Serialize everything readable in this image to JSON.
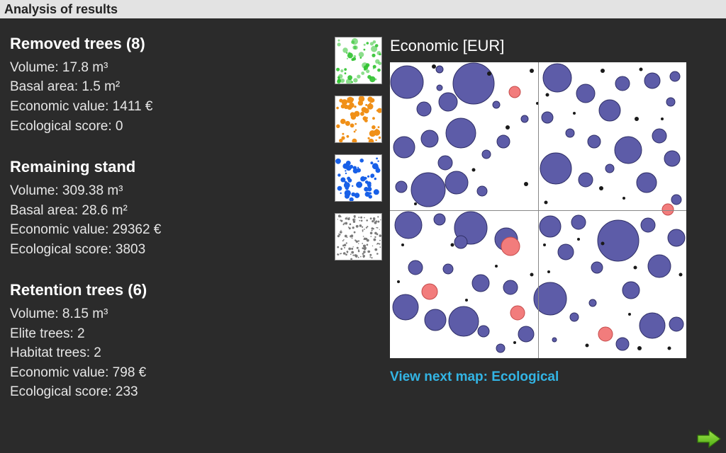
{
  "title": "Analysis of results",
  "removed": {
    "heading": "Removed trees (8)",
    "volume": "Volume: 17.8 m³",
    "basal": "Basal area: 1.5 m²",
    "econ": "Economic value: 1411 €",
    "eco": "Ecological score: 0"
  },
  "remaining": {
    "heading": "Remaining stand",
    "volume": "Volume: 309.38 m³",
    "basal": "Basal area: 28.6 m²",
    "econ": "Economic value: 29362 €",
    "eco": "Ecological score: 3803"
  },
  "retention": {
    "heading": "Retention trees (6)",
    "volume": "Volume: 8.15 m³",
    "elite": "Elite trees: 2",
    "habitat": "Habitat trees: 2",
    "econ": "Economic value: 798 €",
    "eco": "Ecological score: 233"
  },
  "map": {
    "title": "Economic [EUR]",
    "next_label": "View next map: Ecological"
  },
  "thumbs": [
    {
      "name": "thumb-green",
      "color": "#2ec22e"
    },
    {
      "name": "thumb-orange",
      "color": "#f09018"
    },
    {
      "name": "thumb-blue",
      "color": "#1860e8"
    },
    {
      "name": "thumb-gray",
      "color": "#7a7a7a"
    }
  ],
  "chart_data": {
    "type": "scatter",
    "title": "Economic [EUR]",
    "xlim": [
      0,
      418
    ],
    "ylim": [
      0,
      418
    ],
    "note": "Map of tree positions and relative economic value (circle radius ~ value). Salmon circles mark highlighted trees.",
    "series": [
      {
        "name": "main",
        "color": "#5d5ca8",
        "points": [
          {
            "x": 24,
            "y": 28,
            "r": 23
          },
          {
            "x": 70,
            "y": 10,
            "r": 5
          },
          {
            "x": 118,
            "y": 30,
            "r": 29
          },
          {
            "x": 48,
            "y": 66,
            "r": 10
          },
          {
            "x": 82,
            "y": 56,
            "r": 13
          },
          {
            "x": 70,
            "y": 36,
            "r": 4
          },
          {
            "x": 20,
            "y": 120,
            "r": 15
          },
          {
            "x": 56,
            "y": 108,
            "r": 12
          },
          {
            "x": 100,
            "y": 100,
            "r": 21
          },
          {
            "x": 78,
            "y": 142,
            "r": 10
          },
          {
            "x": 16,
            "y": 176,
            "r": 8
          },
          {
            "x": 54,
            "y": 180,
            "r": 24
          },
          {
            "x": 94,
            "y": 170,
            "r": 16
          },
          {
            "x": 130,
            "y": 182,
            "r": 7
          },
          {
            "x": 136,
            "y": 130,
            "r": 6
          },
          {
            "x": 160,
            "y": 112,
            "r": 9
          },
          {
            "x": 190,
            "y": 80,
            "r": 5
          },
          {
            "x": 150,
            "y": 60,
            "r": 5
          },
          {
            "x": 236,
            "y": 22,
            "r": 20
          },
          {
            "x": 276,
            "y": 44,
            "r": 13
          },
          {
            "x": 328,
            "y": 30,
            "r": 10
          },
          {
            "x": 310,
            "y": 68,
            "r": 15
          },
          {
            "x": 222,
            "y": 78,
            "r": 8
          },
          {
            "x": 254,
            "y": 100,
            "r": 6
          },
          {
            "x": 288,
            "y": 112,
            "r": 9
          },
          {
            "x": 370,
            "y": 26,
            "r": 11
          },
          {
            "x": 402,
            "y": 20,
            "r": 7
          },
          {
            "x": 396,
            "y": 56,
            "r": 6
          },
          {
            "x": 234,
            "y": 150,
            "r": 22
          },
          {
            "x": 276,
            "y": 166,
            "r": 10
          },
          {
            "x": 310,
            "y": 150,
            "r": 6
          },
          {
            "x": 336,
            "y": 124,
            "r": 19
          },
          {
            "x": 380,
            "y": 104,
            "r": 10
          },
          {
            "x": 362,
            "y": 170,
            "r": 14
          },
          {
            "x": 398,
            "y": 136,
            "r": 11
          },
          {
            "x": 404,
            "y": 194,
            "r": 7
          },
          {
            "x": 26,
            "y": 230,
            "r": 19
          },
          {
            "x": 70,
            "y": 222,
            "r": 8
          },
          {
            "x": 114,
            "y": 234,
            "r": 23
          },
          {
            "x": 100,
            "y": 254,
            "r": 9
          },
          {
            "x": 164,
            "y": 250,
            "r": 16
          },
          {
            "x": 36,
            "y": 290,
            "r": 10
          },
          {
            "x": 82,
            "y": 292,
            "r": 7
          },
          {
            "x": 128,
            "y": 312,
            "r": 12
          },
          {
            "x": 170,
            "y": 318,
            "r": 10
          },
          {
            "x": 22,
            "y": 346,
            "r": 18
          },
          {
            "x": 64,
            "y": 364,
            "r": 15
          },
          {
            "x": 104,
            "y": 366,
            "r": 21
          },
          {
            "x": 132,
            "y": 380,
            "r": 8
          },
          {
            "x": 156,
            "y": 404,
            "r": 6
          },
          {
            "x": 192,
            "y": 384,
            "r": 11
          },
          {
            "x": 226,
            "y": 232,
            "r": 15
          },
          {
            "x": 266,
            "y": 226,
            "r": 10
          },
          {
            "x": 248,
            "y": 268,
            "r": 11
          },
          {
            "x": 322,
            "y": 252,
            "r": 29
          },
          {
            "x": 292,
            "y": 290,
            "r": 8
          },
          {
            "x": 364,
            "y": 230,
            "r": 10
          },
          {
            "x": 404,
            "y": 248,
            "r": 12
          },
          {
            "x": 380,
            "y": 288,
            "r": 16
          },
          {
            "x": 226,
            "y": 334,
            "r": 23
          },
          {
            "x": 260,
            "y": 360,
            "r": 6
          },
          {
            "x": 232,
            "y": 392,
            "r": 3
          },
          {
            "x": 286,
            "y": 340,
            "r": 5
          },
          {
            "x": 340,
            "y": 322,
            "r": 12
          },
          {
            "x": 370,
            "y": 372,
            "r": 18
          },
          {
            "x": 404,
            "y": 370,
            "r": 10
          },
          {
            "x": 328,
            "y": 398,
            "r": 9
          }
        ]
      },
      {
        "name": "highlight",
        "color": "#f27c7c",
        "points": [
          {
            "x": 176,
            "y": 42,
            "r": 8
          },
          {
            "x": 392,
            "y": 208,
            "r": 8
          },
          {
            "x": 170,
            "y": 260,
            "r": 13
          },
          {
            "x": 56,
            "y": 324,
            "r": 11
          },
          {
            "x": 180,
            "y": 354,
            "r": 10
          },
          {
            "x": 304,
            "y": 384,
            "r": 10
          }
        ]
      },
      {
        "name": "tiny-fill",
        "color": "#1a1a1a",
        "points": [
          {
            "x": 62,
            "y": 6,
            "r": 3
          },
          {
            "x": 140,
            "y": 16,
            "r": 3
          },
          {
            "x": 200,
            "y": 12,
            "r": 3
          },
          {
            "x": 208,
            "y": 58,
            "r": 2
          },
          {
            "x": 166,
            "y": 92,
            "r": 3
          },
          {
            "x": 118,
            "y": 152,
            "r": 2.5
          },
          {
            "x": 192,
            "y": 172,
            "r": 3
          },
          {
            "x": 36,
            "y": 200,
            "r": 2
          },
          {
            "x": 222,
            "y": 46,
            "r": 2.5
          },
          {
            "x": 300,
            "y": 12,
            "r": 3
          },
          {
            "x": 354,
            "y": 10,
            "r": 2.5
          },
          {
            "x": 260,
            "y": 72,
            "r": 2
          },
          {
            "x": 348,
            "y": 80,
            "r": 3
          },
          {
            "x": 384,
            "y": 80,
            "r": 2
          },
          {
            "x": 298,
            "y": 178,
            "r": 3
          },
          {
            "x": 330,
            "y": 192,
            "r": 2
          },
          {
            "x": 220,
            "y": 198,
            "r": 2.5
          },
          {
            "x": 18,
            "y": 258,
            "r": 2
          },
          {
            "x": 88,
            "y": 258,
            "r": 2.5
          },
          {
            "x": 150,
            "y": 288,
            "r": 2
          },
          {
            "x": 200,
            "y": 300,
            "r": 2.5
          },
          {
            "x": 12,
            "y": 310,
            "r": 2
          },
          {
            "x": 108,
            "y": 336,
            "r": 2
          },
          {
            "x": 176,
            "y": 396,
            "r": 2
          },
          {
            "x": 218,
            "y": 258,
            "r": 2
          },
          {
            "x": 266,
            "y": 250,
            "r": 2
          },
          {
            "x": 300,
            "y": 256,
            "r": 2.5
          },
          {
            "x": 346,
            "y": 290,
            "r": 2.5
          },
          {
            "x": 410,
            "y": 300,
            "r": 2.5
          },
          {
            "x": 224,
            "y": 296,
            "r": 2
          },
          {
            "x": 278,
            "y": 400,
            "r": 2.5
          },
          {
            "x": 338,
            "y": 356,
            "r": 2
          },
          {
            "x": 394,
            "y": 404,
            "r": 2.5
          },
          {
            "x": 352,
            "y": 404,
            "r": 3
          }
        ]
      }
    ]
  }
}
